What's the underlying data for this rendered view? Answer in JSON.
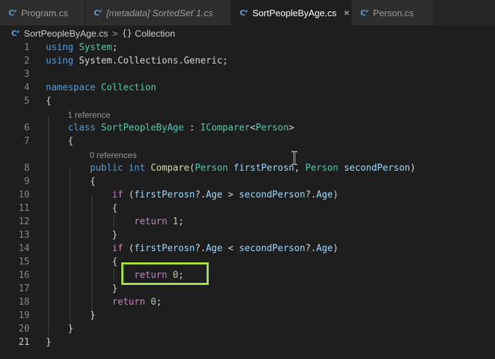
{
  "tabs": [
    {
      "label": "Program.cs",
      "italic": false,
      "active": false
    },
    {
      "label": "[metadata] SortedSet`1.cs",
      "italic": true,
      "active": false
    },
    {
      "label": "SortPeopleByAge.cs",
      "italic": false,
      "active": true,
      "close": "×"
    },
    {
      "label": "Person.cs",
      "italic": false,
      "active": false
    }
  ],
  "breadcrumb": {
    "file": "SortPeopleByAge.cs",
    "separator": ">",
    "symbol_icon": "{}",
    "symbol": "Collection"
  },
  "code_lens": {
    "class_refs": "1 reference",
    "method_refs": "0 references"
  },
  "lines": [
    {
      "num": "1",
      "tokens": [
        {
          "t": "using",
          "c": "kw"
        },
        {
          "t": " "
        },
        {
          "t": "System",
          "c": "ty"
        },
        {
          "t": ";"
        }
      ]
    },
    {
      "num": "2",
      "tokens": [
        {
          "t": "using",
          "c": "kw"
        },
        {
          "t": " System.Collections.Generic;"
        }
      ]
    },
    {
      "num": "3",
      "tokens": []
    },
    {
      "num": "4",
      "tokens": [
        {
          "t": "namespace",
          "c": "kw"
        },
        {
          "t": " "
        },
        {
          "t": "Collection",
          "c": "ty"
        }
      ]
    },
    {
      "num": "5",
      "tokens": [
        {
          "t": "{"
        }
      ]
    },
    {
      "num": "6",
      "tokens": [
        {
          "t": "    "
        },
        {
          "t": "class",
          "c": "kw"
        },
        {
          "t": " "
        },
        {
          "t": "SortPeopleByAge",
          "c": "ty"
        },
        {
          "t": " : "
        },
        {
          "t": "IComparer",
          "c": "ty"
        },
        {
          "t": "<"
        },
        {
          "t": "Person",
          "c": "ty"
        },
        {
          "t": ">"
        }
      ]
    },
    {
      "num": "7",
      "tokens": [
        {
          "t": "    {"
        }
      ]
    },
    {
      "num": "8",
      "tokens": [
        {
          "t": "        "
        },
        {
          "t": "public",
          "c": "kw"
        },
        {
          "t": " "
        },
        {
          "t": "int",
          "c": "kw"
        },
        {
          "t": " "
        },
        {
          "t": "Compare",
          "c": "fn"
        },
        {
          "t": "("
        },
        {
          "t": "Person",
          "c": "ty"
        },
        {
          "t": " "
        },
        {
          "t": "firstPerosn",
          "c": "var"
        },
        {
          "t": ", "
        },
        {
          "t": "Person",
          "c": "ty"
        },
        {
          "t": " "
        },
        {
          "t": "secondPerson",
          "c": "var"
        },
        {
          "t": ")"
        }
      ]
    },
    {
      "num": "9",
      "tokens": [
        {
          "t": "        {"
        }
      ]
    },
    {
      "num": "10",
      "tokens": [
        {
          "t": "            "
        },
        {
          "t": "if",
          "c": "ctl"
        },
        {
          "t": " ("
        },
        {
          "t": "firstPerosn",
          "c": "var"
        },
        {
          "t": "?."
        },
        {
          "t": "Age",
          "c": "var"
        },
        {
          "t": " > "
        },
        {
          "t": "secondPerson",
          "c": "var"
        },
        {
          "t": "?."
        },
        {
          "t": "Age",
          "c": "var"
        },
        {
          "t": ")"
        }
      ]
    },
    {
      "num": "11",
      "tokens": [
        {
          "t": "            {"
        }
      ]
    },
    {
      "num": "12",
      "tokens": [
        {
          "t": "                "
        },
        {
          "t": "return",
          "c": "ctl"
        },
        {
          "t": " "
        },
        {
          "t": "1",
          "c": "num"
        },
        {
          "t": ";"
        }
      ]
    },
    {
      "num": "13",
      "tokens": [
        {
          "t": "            }"
        }
      ]
    },
    {
      "num": "14",
      "tokens": [
        {
          "t": "            "
        },
        {
          "t": "if",
          "c": "ctl"
        },
        {
          "t": " ("
        },
        {
          "t": "firstPerosn",
          "c": "var"
        },
        {
          "t": "?."
        },
        {
          "t": "Age",
          "c": "var"
        },
        {
          "t": " < "
        },
        {
          "t": "secondPerson",
          "c": "var"
        },
        {
          "t": "?."
        },
        {
          "t": "Age",
          "c": "var"
        },
        {
          "t": ")"
        }
      ]
    },
    {
      "num": "15",
      "tokens": [
        {
          "t": "            {"
        }
      ]
    },
    {
      "num": "16",
      "tokens": [
        {
          "t": "                "
        },
        {
          "t": "return",
          "c": "ctl"
        },
        {
          "t": " "
        },
        {
          "t": "0",
          "c": "num"
        },
        {
          "t": ";"
        }
      ]
    },
    {
      "num": "17",
      "tokens": [
        {
          "t": "            }"
        }
      ]
    },
    {
      "num": "18",
      "tokens": [
        {
          "t": "            "
        },
        {
          "t": "return",
          "c": "ctl"
        },
        {
          "t": " "
        },
        {
          "t": "0",
          "c": "num"
        },
        {
          "t": ";"
        }
      ]
    },
    {
      "num": "19",
      "tokens": [
        {
          "t": "        }"
        }
      ]
    },
    {
      "num": "20",
      "tokens": [
        {
          "t": "    }"
        }
      ]
    },
    {
      "num": "21",
      "tokens": [
        {
          "t": "}"
        }
      ],
      "current": true
    }
  ],
  "colors": {
    "editor_bg": "#1e1e1e",
    "tab_bg": "#2d2d2d",
    "highlight": "#a8e13c",
    "csharp_icon": "#5c9fd6"
  }
}
